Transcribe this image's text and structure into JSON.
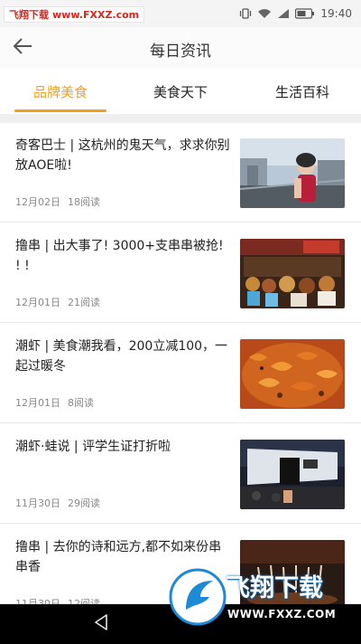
{
  "watermark": {
    "top_brand": "飞翔下载",
    "top_url": "www.FXXZ.com",
    "bottom_brand": "飞翔下载",
    "bottom_url": "WWW.FXXZ.COM"
  },
  "status_bar": {
    "time": "19:40",
    "icons": [
      "vibrate-icon",
      "wifi-icon",
      "signal-icon",
      "battery-icon"
    ]
  },
  "header": {
    "title": "每日资讯",
    "back_icon": "arrow-left-icon"
  },
  "tabs": [
    {
      "label": "品牌美食",
      "active": true
    },
    {
      "label": "美食天下",
      "active": false
    },
    {
      "label": "生活百科",
      "active": false
    }
  ],
  "colors": {
    "accent": "#f0a11a",
    "divider": "#efefef"
  },
  "articles": [
    {
      "title": "奇客巴士 | 这杭州的鬼天气，求求你别放AOE啦!",
      "date": "12月02日",
      "reads": "18阅读",
      "thumb": "person-in-city-photo"
    },
    {
      "title": "撸串 | 出大事了! 3000+支串串被抢! ! !",
      "date": "12月01日",
      "reads": "21阅读",
      "thumb": "skewer-food-stall-photo"
    },
    {
      "title": "潮虾 | 美食潮我看，200立减100，一起过暖冬",
      "date": "12月01日",
      "reads": "8阅读",
      "thumb": "crayfish-dish-photo"
    },
    {
      "title": "潮虾·蛙说 | 评学生证打折啦",
      "date": "11月30日",
      "reads": "29阅读",
      "thumb": "storefront-night-photo"
    },
    {
      "title": "撸串 | 去你的诗和远方,都不如来份串串香",
      "date": "11月30日",
      "reads": "12阅读",
      "thumb": "skewers-closeup-photo"
    }
  ],
  "nav_bar": {
    "back_icon": "triangle-back-icon"
  }
}
